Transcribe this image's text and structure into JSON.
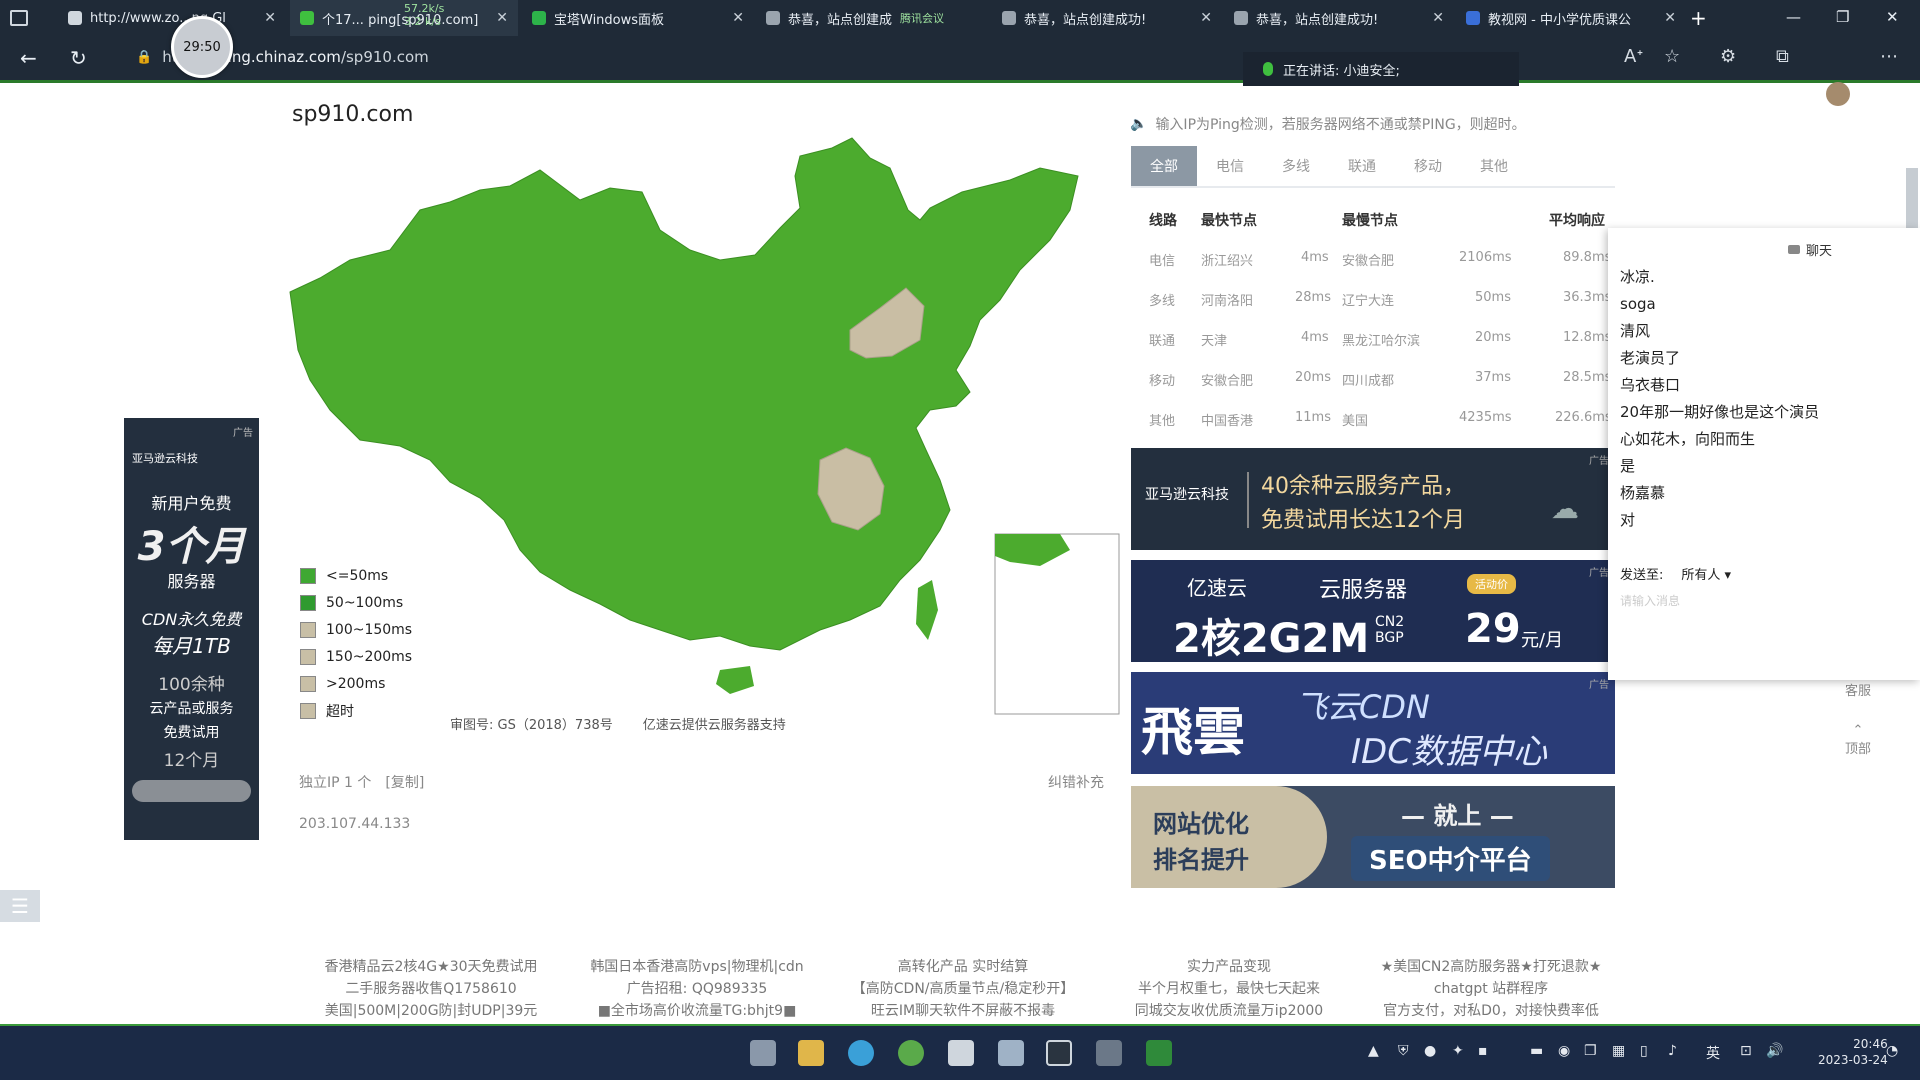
{
  "browser": {
    "tabs": [
      {
        "label": "http://www.zo...ng Gl",
        "close": "✕"
      },
      {
        "label": "个17... ping[sp910.com]",
        "close": "✕"
      },
      {
        "label": "宝塔Windows面板",
        "close": "✕"
      },
      {
        "label": "恭喜，站点创建成",
        "close": "✕"
      },
      {
        "label": "恭喜，站点创建成功!",
        "close": "✕"
      },
      {
        "label": "恭喜，站点创建成功!",
        "close": "✕"
      },
      {
        "label": "教视网 - 中小学优质课公",
        "close": "✕"
      }
    ],
    "meeting_label": "腾讯会议",
    "net_speed": [
      "57.2k/s",
      "3.2 k/s"
    ],
    "timer": "29:50",
    "url_prefix": "http://",
    "url_host": "ping.chinaz.com",
    "url_path": "/sp910.com",
    "speaking": "正在讲话: 小迪安全;",
    "new_tab": "+",
    "window_controls": [
      "—",
      "❐",
      "✕"
    ]
  },
  "page": {
    "domain": "sp910.com",
    "legend": [
      {
        "label": "<=50ms",
        "color": "#3fa832"
      },
      {
        "label": "50~100ms",
        "color": "#2f9a2f"
      },
      {
        "label": "100~150ms",
        "color": "#c8bfa6"
      },
      {
        "label": "150~200ms",
        "color": "#c8bfa6"
      },
      {
        "label": ">200ms",
        "color": "#c8bfa6"
      },
      {
        "label": "超时",
        "color": "#c8bfa6"
      }
    ],
    "map_caption": [
      "审图号: GS（2018）738号",
      "亿速云提供云服务器支持"
    ],
    "independent_ip": "独立IP 1 个",
    "copy": "[复制]",
    "correct": "纠错补充",
    "ip": "203.107.44.133",
    "map_colors": {
      "green": "#4cab2e",
      "tan": "#c9bea4"
    }
  },
  "left_ad": {
    "tag": "广告",
    "brand": "亚马逊云科技",
    "line1": "新用户免费",
    "line2": "3个月",
    "line3": "服务器",
    "line4": "CDN永久免费",
    "line5": "每月1TB",
    "line6": "100余种",
    "line7": "云产品或服务",
    "line8": "免费试用",
    "line9": "12个月"
  },
  "ping": {
    "hint": "输入IP为Ping检测，若服务器网络不通或禁PING，则超时。",
    "tabs": [
      "全部",
      "电信",
      "多线",
      "联通",
      "移动",
      "其他"
    ],
    "headers": [
      "线路",
      "最快节点",
      "最慢节点",
      "平均响应"
    ],
    "rows": [
      {
        "line": "电信",
        "fast_node": "浙江绍兴",
        "fast_ms": "4ms",
        "slow_node": "安徽合肥",
        "slow_ms": "2106ms",
        "avg": "89.8ms"
      },
      {
        "line": "多线",
        "fast_node": "河南洛阳",
        "fast_ms": "28ms",
        "slow_node": "辽宁大连",
        "slow_ms": "50ms",
        "avg": "36.3ms"
      },
      {
        "line": "联通",
        "fast_node": "天津",
        "fast_ms": "4ms",
        "slow_node": "黑龙江哈尔滨",
        "slow_ms": "20ms",
        "avg": "12.8ms"
      },
      {
        "line": "移动",
        "fast_node": "安徽合肥",
        "fast_ms": "20ms",
        "slow_node": "四川成都",
        "slow_ms": "37ms",
        "avg": "28.5ms"
      },
      {
        "line": "其他",
        "fast_node": "中国香港",
        "fast_ms": "11ms",
        "slow_node": "美国",
        "slow_ms": "4235ms",
        "avg": "226.6ms"
      }
    ]
  },
  "right_ads": {
    "ad1": {
      "tag": "广告",
      "brand": "亚马逊云科技",
      "text1": "40余种云服务产品，",
      "text2": "免费试用长达12个月"
    },
    "ad2": {
      "tag": "广告",
      "brand": "亿速云",
      "title": "云服务器",
      "spec": "2核2G2M",
      "sub": "CN2 BGP",
      "badge": "活动价",
      "price": "29",
      "unit": "元/月"
    },
    "ad3": {
      "tag": "广告",
      "logo": "飛雲",
      "line1": "飞云CDN",
      "line2": "IDC数据中心"
    },
    "ad4": {
      "line1": "网站优化",
      "line2": "排名提升",
      "line3": "— 就上 —",
      "line4": "SEO中介平台"
    }
  },
  "chat": {
    "title": "聊天",
    "messages": [
      "冰凉.",
      "soga",
      "清风",
      "老演员了",
      "乌衣巷口",
      "20年那一期好像也是这个演员",
      "心如花木，向阳而生",
      "是",
      "杨嘉慕",
      "对"
    ],
    "send_to_label": "发送至:",
    "send_to_value": "所有人",
    "input_placeholder": "请输入消息"
  },
  "side_tools": [
    "客服",
    "顶部"
  ],
  "footer": [
    [
      "香港精品云2核4G★30天免费试用",
      "二手服务器收售Q1758610",
      "美国|500M|200G防|封UDP|39元"
    ],
    [
      "韩国日本香港高防vps|物理机|cdn",
      "广告招租: QQ989335",
      "■全市场高价收流量TG:bhjt9■"
    ],
    [
      "高转化产品 实时结算",
      "【高防CDN/高质量节点/稳定秒开】",
      "旺云IM聊天软件不屏蔽不报毒"
    ],
    [
      "实力产品变现",
      "半个月权重七，最快七天起来",
      "同城交友收优质流量万ip2000"
    ],
    [
      "★美国CN2高防服务器★打死退款★",
      "chatgpt 站群程序",
      "官方支付，对私D0，对接快费率低"
    ]
  ],
  "taskbar": {
    "time": "20:46",
    "date": "2023-03-24",
    "ime": "英"
  }
}
